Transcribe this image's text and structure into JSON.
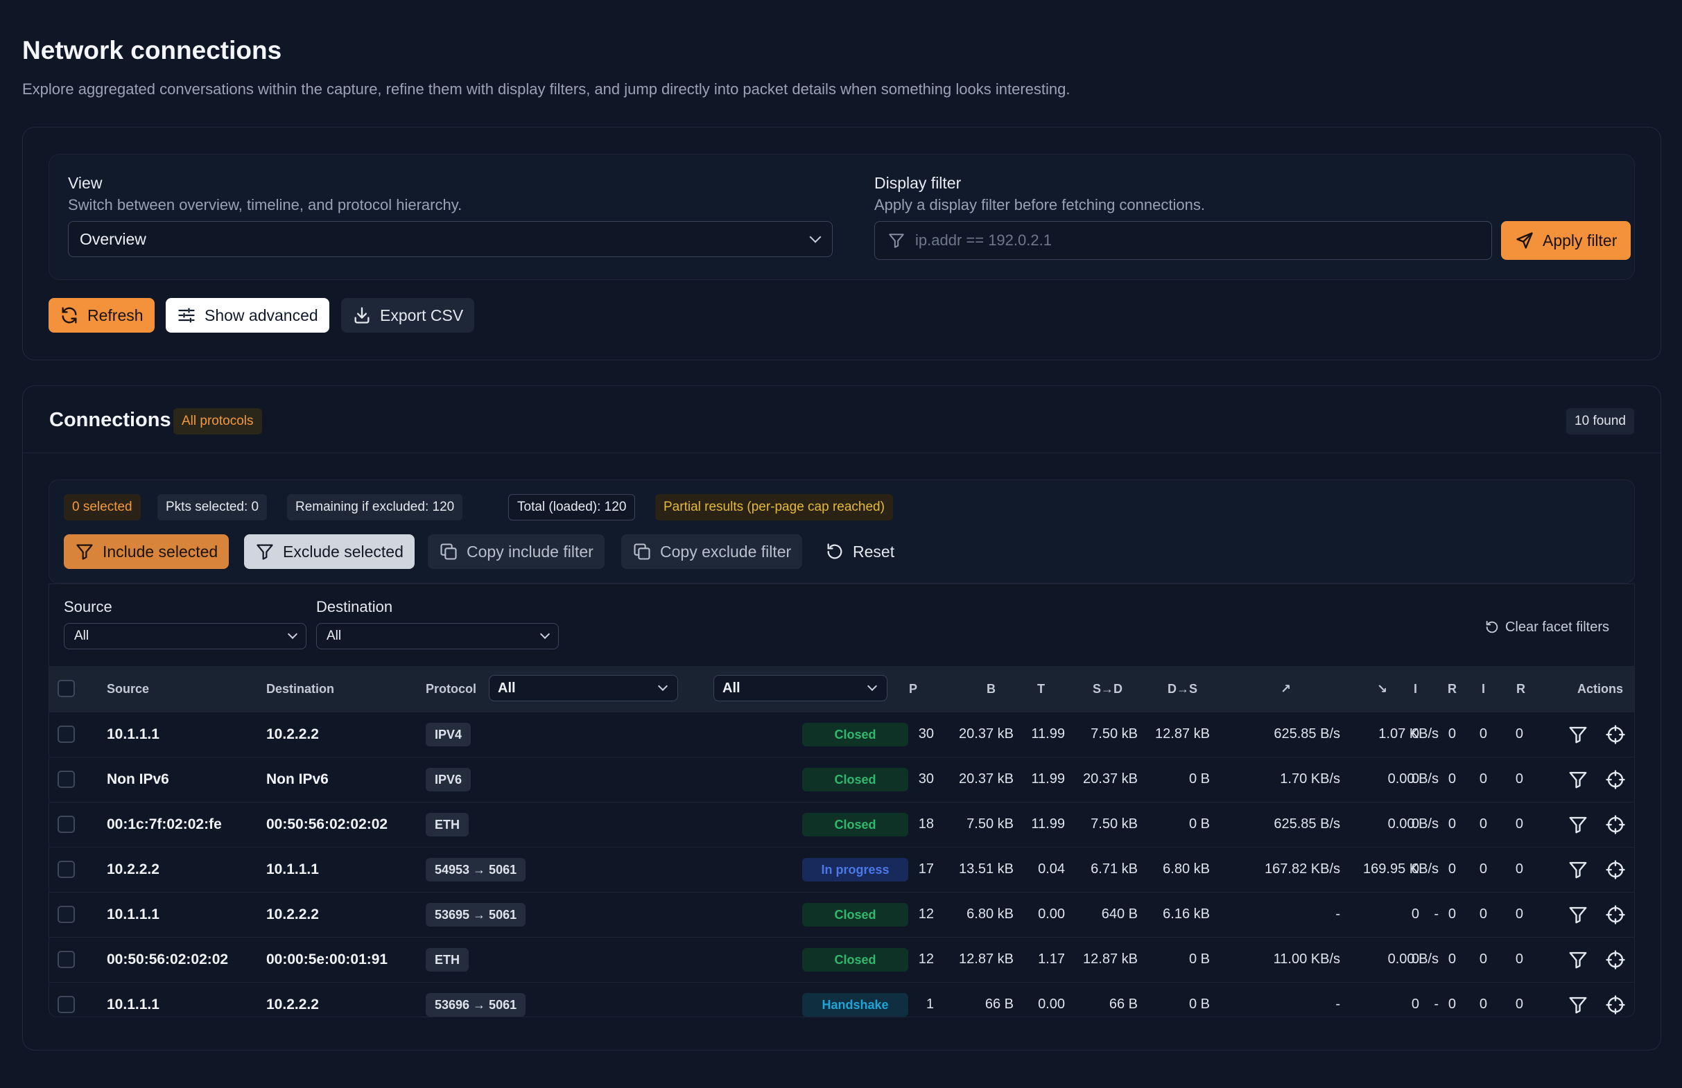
{
  "page": {
    "title": "Network connections",
    "description": "Explore aggregated conversations within the capture, refine them with display filters, and jump directly into packet details when something looks interesting."
  },
  "controls": {
    "view_label": "View",
    "view_help": "Switch between overview, timeline, and protocol hierarchy.",
    "view_value": "Overview",
    "filter_label": "Display filter",
    "filter_help": "Apply a display filter before fetching connections.",
    "filter_placeholder": "ip.addr == 192.0.2.1",
    "apply_label": "Apply filter",
    "refresh_label": "Refresh",
    "advanced_label": "Show advanced",
    "export_label": "Export CSV"
  },
  "connections": {
    "title": "Connections",
    "protocol_badge": "All protocols",
    "found": "10 found",
    "selection": {
      "selected": "0 selected",
      "pkts_selected": "Pkts selected: 0",
      "remaining": "Remaining if excluded: 120",
      "total": "Total (loaded): 120",
      "partial": "Partial results (per-page cap reached)",
      "include": "Include selected",
      "exclude": "Exclude selected",
      "copy_include": "Copy include filter",
      "copy_exclude": "Copy exclude filter",
      "reset": "Reset"
    },
    "facets": {
      "source_label": "Source",
      "source_value": "All",
      "destination_label": "Destination",
      "destination_value": "All",
      "clear_label": "Clear facet filters"
    },
    "columns": {
      "source": "Source",
      "destination": "Destination",
      "protocol": "Protocol",
      "protocol_filter": "All",
      "status_filter": "All",
      "p": "P",
      "b": "B",
      "t": "T",
      "sd": "S→D",
      "ds": "D→S",
      "up": "↗",
      "down": "↘",
      "i1": "I",
      "r1": "R",
      "i2": "I",
      "r2": "R",
      "actions": "Actions"
    },
    "rows": [
      {
        "source": "10.1.1.1",
        "destination": "10.2.2.2",
        "protocol": "IPV4",
        "status": "Closed",
        "status_kind": "closed",
        "p": "30",
        "b": "20.37 kB",
        "t": "11.99",
        "sd": "7.50 kB",
        "ds": "12.87 kB",
        "up": "625.85 B/s",
        "down": "1.07 KB/s",
        "i1": "0",
        "r1": "0",
        "i2": "0",
        "r2": "0"
      },
      {
        "source": "Non IPv6",
        "destination": "Non IPv6",
        "protocol": "IPV6",
        "status": "Closed",
        "status_kind": "closed",
        "p": "30",
        "b": "20.37 kB",
        "t": "11.99",
        "sd": "20.37 kB",
        "ds": "0 B",
        "up": "1.70 KB/s",
        "down": "0.00 B/s",
        "i1": "0",
        "r1": "0",
        "i2": "0",
        "r2": "0"
      },
      {
        "source": "00:1c:7f:02:02:fe",
        "destination": "00:50:56:02:02:02",
        "protocol": "ETH",
        "status": "Closed",
        "status_kind": "closed",
        "p": "18",
        "b": "7.50 kB",
        "t": "11.99",
        "sd": "7.50 kB",
        "ds": "0 B",
        "up": "625.85 B/s",
        "down": "0.00 B/s",
        "i1": "0",
        "r1": "0",
        "i2": "0",
        "r2": "0"
      },
      {
        "source": "10.2.2.2",
        "destination": "10.1.1.1",
        "protocol": "54953 → 5061",
        "status": "In progress",
        "status_kind": "progress",
        "p": "17",
        "b": "13.51 kB",
        "t": "0.04",
        "sd": "6.71 kB",
        "ds": "6.80 kB",
        "up": "167.82 KB/s",
        "down": "169.95 KB/s",
        "i1": "0",
        "r1": "0",
        "i2": "0",
        "r2": "0"
      },
      {
        "source": "10.1.1.1",
        "destination": "10.2.2.2",
        "protocol": "53695 → 5061",
        "status": "Closed",
        "status_kind": "closed",
        "p": "12",
        "b": "6.80 kB",
        "t": "0.00",
        "sd": "640 B",
        "ds": "6.16 kB",
        "up": "-",
        "down": "-",
        "i1": "0",
        "r1": "0",
        "i2": "0",
        "r2": "0"
      },
      {
        "source": "00:50:56:02:02:02",
        "destination": "00:00:5e:00:01:91",
        "protocol": "ETH",
        "status": "Closed",
        "status_kind": "closed",
        "p": "12",
        "b": "12.87 kB",
        "t": "1.17",
        "sd": "12.87 kB",
        "ds": "0 B",
        "up": "11.00 KB/s",
        "down": "0.00 B/s",
        "i1": "0",
        "r1": "0",
        "i2": "0",
        "r2": "0"
      },
      {
        "source": "10.1.1.1",
        "destination": "10.2.2.2",
        "protocol": "53696 → 5061",
        "status": "Handshake",
        "status_kind": "handshake",
        "p": "1",
        "b": "66 B",
        "t": "0.00",
        "sd": "66 B",
        "ds": "0 B",
        "up": "-",
        "down": "-",
        "i1": "0",
        "r1": "0",
        "i2": "0",
        "r2": "0"
      }
    ]
  },
  "colors": {
    "background": "#0f1626",
    "accent_orange": "#f4923b",
    "status_closed": "#30b86e",
    "status_progress": "#4a78e9",
    "status_handshake": "#1fa4d8",
    "warning_text": "#e4b93a"
  },
  "icons": [
    "chevron-down-icon",
    "filter-icon",
    "send-icon",
    "refresh-icon",
    "sliders-icon",
    "download-icon",
    "copy-icon",
    "reset-icon",
    "crosshair-icon"
  ]
}
